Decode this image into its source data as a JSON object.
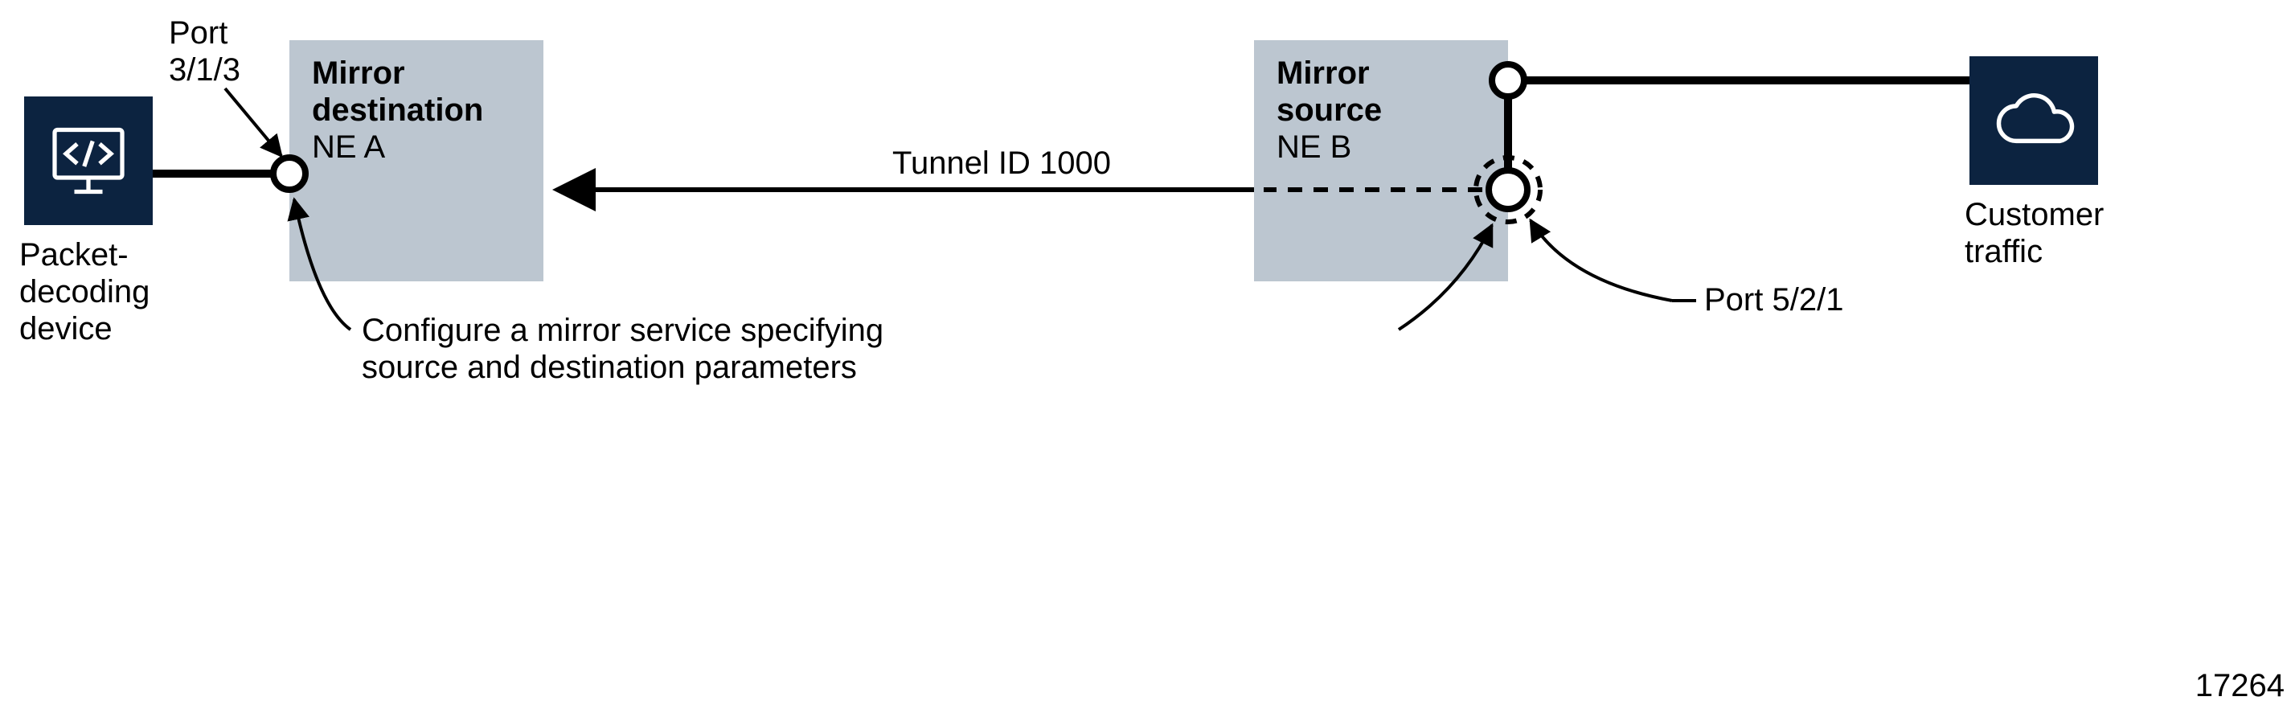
{
  "diagram": {
    "figure_number": "17264",
    "decoder": {
      "label_line1": "Packet-",
      "label_line2": "decoding",
      "label_line3": "device"
    },
    "cloud": {
      "label_line1": "Customer",
      "label_line2": "traffic"
    },
    "ne_a": {
      "title": "Mirror",
      "title2": "destination",
      "sub": "NE A"
    },
    "ne_b": {
      "title": "Mirror",
      "title2": "source",
      "sub": "NE B"
    },
    "port_a": {
      "label_line1": "Port",
      "label_line2": "3/1/3"
    },
    "port_b": {
      "label": "Port 5/2/1"
    },
    "tunnel": {
      "label": "Tunnel ID 1000"
    },
    "note": {
      "line1": "Configure a mirror service specifying",
      "line2": "source and destination parameters"
    }
  }
}
